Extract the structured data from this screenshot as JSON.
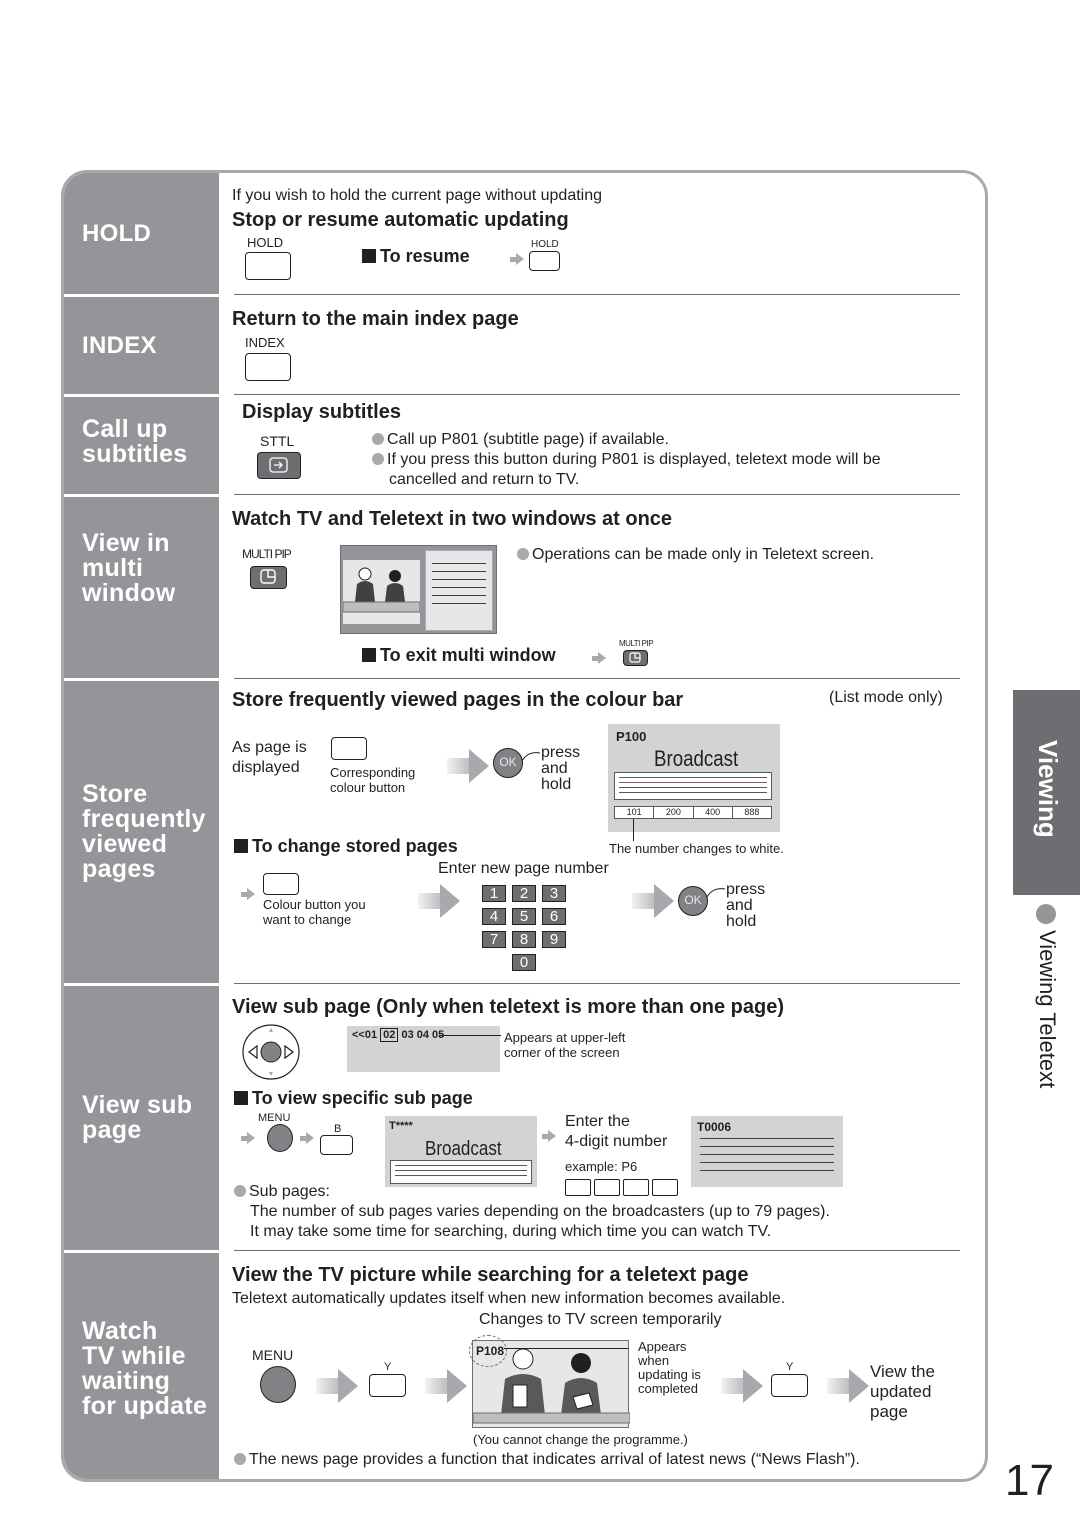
{
  "page_number": "17",
  "side_tab": {
    "label": "Viewing",
    "section": "Viewing Teletext"
  },
  "sections": [
    {
      "label": "HOLD"
    },
    {
      "label": "INDEX"
    },
    {
      "label": "Call up\nsubtitles"
    },
    {
      "label": "View in\nmulti\nwindow"
    },
    {
      "label": "Store\nfrequently\nviewed\npages"
    },
    {
      "label": "View sub\npage"
    },
    {
      "label": "Watch\nTV while\nwaiting\nfor update"
    }
  ],
  "hold": {
    "intro": "If you wish to hold the current page without updating",
    "title": "Stop or resume automatic updating",
    "button_label": "HOLD",
    "resume_label": "To resume",
    "resume_button_label": "HOLD"
  },
  "index": {
    "title": "Return to the main index page",
    "button_label": "INDEX"
  },
  "subtitles": {
    "title": "Display subtitles",
    "button_label": "STTL",
    "bullets": [
      "Call up P801 (subtitle page) if available.",
      "If you press this button during P801 is displayed, teletext mode will be",
      "cancelled and return to TV."
    ]
  },
  "multi": {
    "title": "Watch TV and Teletext in two windows at once",
    "button_label": "MULTI PIP",
    "note": "Operations can be made only in Teletext screen.",
    "exit_label": "To exit multi window",
    "exit_button_label": "MULTI PIP"
  },
  "store": {
    "title": "Store frequently viewed pages in the colour bar",
    "mode_note": "(List mode only)",
    "as_page_line1": "As page is",
    "as_page_line2": "displayed",
    "corresponding_line1": "Corresponding",
    "corresponding_line2": "colour button",
    "ok_label": "OK",
    "press_hold": [
      "press",
      "and",
      "hold"
    ],
    "screen_page": "P100",
    "screen_title": "Broadcast",
    "colour_bar": [
      "101",
      "200",
      "400",
      "888"
    ],
    "changes_note": "The number changes to white.",
    "change_title": "To change stored pages",
    "colour_btn_line1": "Colour button you",
    "colour_btn_line2": "want to change",
    "enter_new": "Enter new page number",
    "keys": [
      "1",
      "2",
      "3",
      "4",
      "5",
      "6",
      "7",
      "8",
      "9",
      "0"
    ],
    "ok_label2": "OK",
    "press_hold2": [
      "press",
      "and",
      "hold"
    ]
  },
  "subpage": {
    "title": "View sub page (Only when teletext is more than one page)",
    "ok_label": "OK",
    "bar_prefix": "<<01",
    "bar_selected": "02",
    "bar_suffix": "03 04 05",
    "appears_line1": "Appears at upper-left",
    "appears_line2": "corner of the screen",
    "specific_title": "To view specific sub page",
    "menu_label": "MENU",
    "b_label": "B",
    "screen_page": "T****",
    "screen_title": "Broadcast",
    "enter_line1": "Enter the",
    "enter_line2": "4-digit number",
    "example": "example: P6",
    "result_page": "T0006",
    "sub_pages_label": "Sub pages:",
    "note_line1": "The number of sub pages varies depending on the broadcasters (up to 79 pages).",
    "note_line2": "It may take some time for searching, during which time you can watch TV."
  },
  "waiting": {
    "title": "View the TV picture while searching for a teletext page",
    "intro": "Teletext automatically updates itself when new information becomes available.",
    "changes": "Changes to TV screen temporarily",
    "menu_label": "MENU",
    "y_label": "Y",
    "y_label2": "Y",
    "screen_page": "P108",
    "appears": [
      "Appears",
      "when",
      "updating is",
      "completed"
    ],
    "view_updated": [
      "View the",
      "updated",
      "page"
    ],
    "cannot_change": "(You cannot change the programme.)",
    "news_note": "The news page provides a function that indicates arrival of latest news (“News Flash”)."
  }
}
